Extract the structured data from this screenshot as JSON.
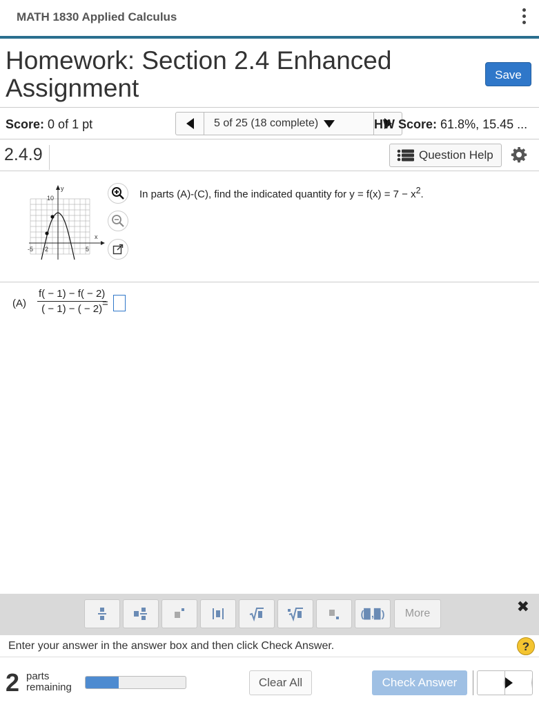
{
  "header": {
    "course_title": "MATH 1830 Applied Calculus"
  },
  "homework": {
    "title": "Homework: Section 2.4 Enhanced Assignment",
    "save_label": "Save"
  },
  "score_bar": {
    "score_label": "Score:",
    "score_value": "0 of 1 pt",
    "question_nav": "5 of 25 (18 complete)",
    "hw_score_label": "HW Score:",
    "hw_score_value": "61.8%, 15.45 ..."
  },
  "question": {
    "number": "2.4.9",
    "help_label": "Question Help",
    "prompt": "In parts (A)-(C), find the indicated quantity for y = f(x) = 7 − x",
    "prompt_sup": "2",
    "prompt_end": ".",
    "graph": {
      "y_label": "y",
      "x_label": "x",
      "y_tick": "10",
      "x_ticks": [
        "-5",
        "-2",
        "5"
      ]
    },
    "part_a": {
      "label": "(A)",
      "numerator": "f( − 1) − f( − 2)",
      "denominator": "( − 1) − ( − 2)",
      "equals": "="
    }
  },
  "math_toolbar": {
    "buttons": [
      "fraction",
      "mixed-number",
      "exponent",
      "absolute-value",
      "square-root",
      "nth-root",
      "subscript",
      "interval"
    ],
    "interval_label": "(▉,▉)",
    "more_label": "More",
    "close": "✖"
  },
  "instructions": {
    "text": "Enter your answer in the answer box and then click Check Answer.",
    "help": "?"
  },
  "footer": {
    "parts_count": "2",
    "parts_line1": "parts",
    "parts_line2": "remaining",
    "progress_fraction": 0.33,
    "clear_label": "Clear All",
    "check_label": "Check Answer"
  },
  "colors": {
    "accent": "#2f77c9",
    "header_rule": "#2a6f8f",
    "check_disabled": "#9fc0e4",
    "help_yellow": "#f4c430"
  }
}
